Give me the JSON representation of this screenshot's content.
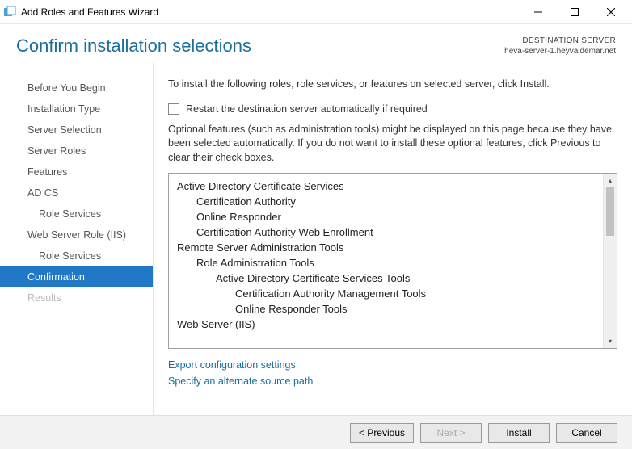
{
  "titlebar": {
    "title": "Add Roles and Features Wizard"
  },
  "header": {
    "title": "Confirm installation selections",
    "dest_label": "DESTINATION SERVER",
    "dest_server": "heva-server-1.heyvaldemar.net"
  },
  "sidebar": {
    "items": [
      {
        "label": "Before You Begin",
        "sub": false,
        "active": false,
        "disabled": false
      },
      {
        "label": "Installation Type",
        "sub": false,
        "active": false,
        "disabled": false
      },
      {
        "label": "Server Selection",
        "sub": false,
        "active": false,
        "disabled": false
      },
      {
        "label": "Server Roles",
        "sub": false,
        "active": false,
        "disabled": false
      },
      {
        "label": "Features",
        "sub": false,
        "active": false,
        "disabled": false
      },
      {
        "label": "AD CS",
        "sub": false,
        "active": false,
        "disabled": false
      },
      {
        "label": "Role Services",
        "sub": true,
        "active": false,
        "disabled": false
      },
      {
        "label": "Web Server Role (IIS)",
        "sub": false,
        "active": false,
        "disabled": false
      },
      {
        "label": "Role Services",
        "sub": true,
        "active": false,
        "disabled": false
      },
      {
        "label": "Confirmation",
        "sub": false,
        "active": true,
        "disabled": false
      },
      {
        "label": "Results",
        "sub": false,
        "active": false,
        "disabled": true
      }
    ]
  },
  "main": {
    "intro": "To install the following roles, role services, or features on selected server, click Install.",
    "checkbox_label": "Restart the destination server automatically if required",
    "note": "Optional features (such as administration tools) might be displayed on this page because they have been selected automatically. If you do not want to install these optional features, click Previous to clear their check boxes.",
    "selections": [
      {
        "text": "Active Directory Certificate Services",
        "level": 0
      },
      {
        "text": "Certification Authority",
        "level": 1
      },
      {
        "text": "Online Responder",
        "level": 1
      },
      {
        "text": "Certification Authority Web Enrollment",
        "level": 1
      },
      {
        "text": "Remote Server Administration Tools",
        "level": 0
      },
      {
        "text": "Role Administration Tools",
        "level": 1
      },
      {
        "text": "Active Directory Certificate Services Tools",
        "level": 2
      },
      {
        "text": "Certification Authority Management Tools",
        "level": 3
      },
      {
        "text": "Online Responder Tools",
        "level": 3
      },
      {
        "text": "Web Server (IIS)",
        "level": 0
      }
    ],
    "link_export": "Export configuration settings",
    "link_source": "Specify an alternate source path"
  },
  "footer": {
    "previous": "< Previous",
    "next": "Next >",
    "install": "Install",
    "cancel": "Cancel"
  }
}
